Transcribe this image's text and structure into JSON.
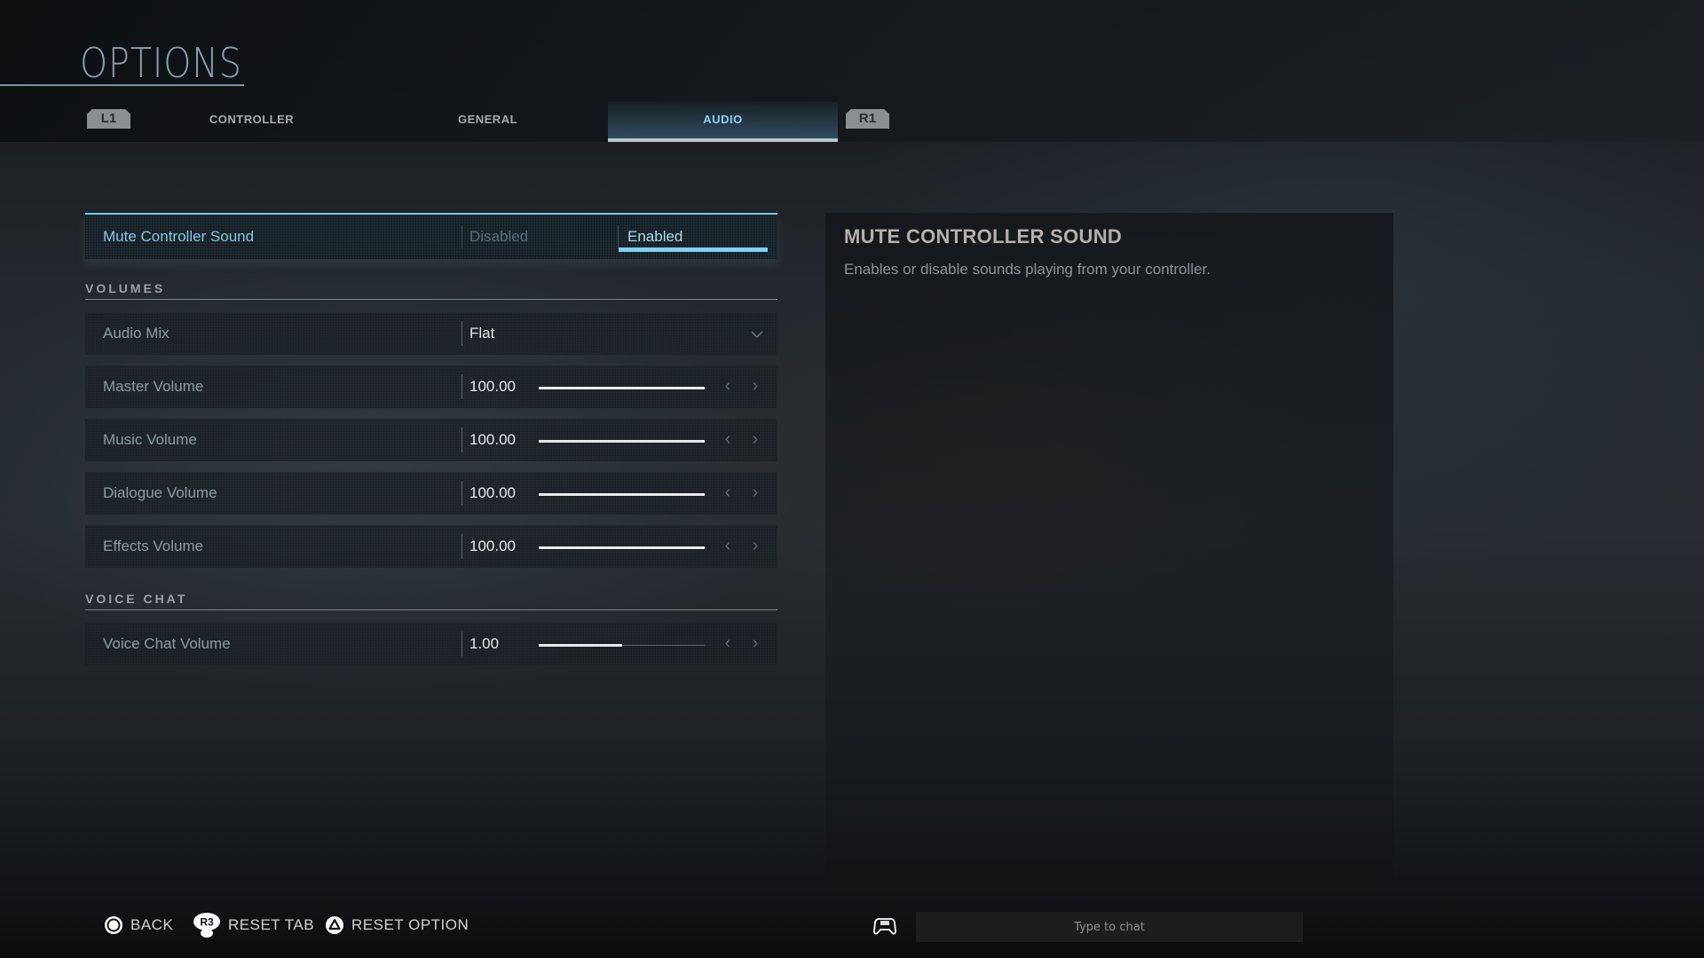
{
  "header": {
    "title": "OPTIONS",
    "prev_tab_hint": "L1",
    "next_tab_hint": "R1",
    "tabs": [
      {
        "label": "CONTROLLER",
        "active": false
      },
      {
        "label": "GENERAL",
        "active": false
      },
      {
        "label": "AUDIO",
        "active": true
      }
    ]
  },
  "settings": {
    "mute_controller": {
      "label": "Mute Controller Sound",
      "options": [
        "Disabled",
        "Enabled"
      ],
      "selected": "Enabled"
    },
    "volumes_section": {
      "title": "VOLUMES",
      "audio_mix": {
        "label": "Audio Mix",
        "value": "Flat"
      },
      "sliders": [
        {
          "label": "Master Volume",
          "value": "100.00",
          "fill_fraction": 1.0
        },
        {
          "label": "Music Volume",
          "value": "100.00",
          "fill_fraction": 1.0
        },
        {
          "label": "Dialogue Volume",
          "value": "100.00",
          "fill_fraction": 1.0
        },
        {
          "label": "Effects Volume",
          "value": "100.00",
          "fill_fraction": 1.0
        }
      ]
    },
    "voice_chat_section": {
      "title": "VOICE CHAT",
      "sliders": [
        {
          "label": "Voice Chat Volume",
          "value": "1.00",
          "fill_fraction": 0.5
        }
      ]
    }
  },
  "description": {
    "title": "MUTE CONTROLLER SOUND",
    "text": "Enables or disable sounds playing from your controller."
  },
  "footer": {
    "back_label": "BACK",
    "reset_tab_label": "RESET TAB",
    "reset_tab_hint": "R3",
    "reset_option_label": "RESET OPTION",
    "chat_placeholder": "Type to chat"
  },
  "colors": {
    "accent": "#7fd0ef",
    "focused_label": "#86c8e6",
    "active_tab_text": "#8fd2f0"
  }
}
